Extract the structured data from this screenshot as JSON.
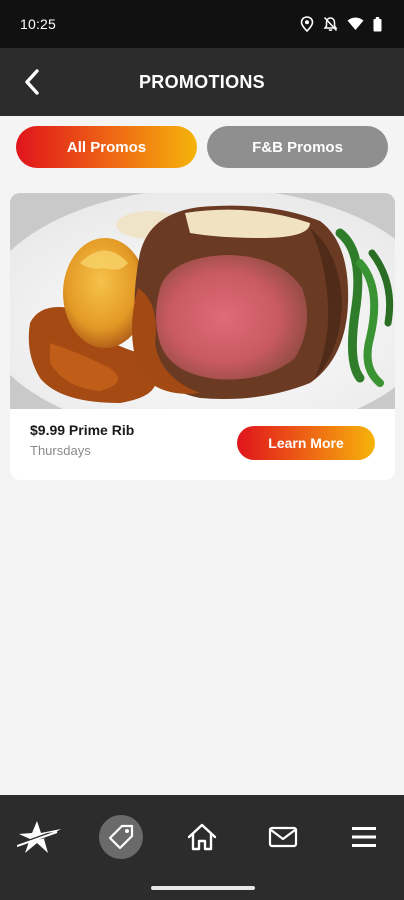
{
  "status_bar": {
    "time": "10:25"
  },
  "header": {
    "title": "PROMOTIONS"
  },
  "filters": {
    "all_label": "All Promos",
    "fnb_label": "F&B Promos"
  },
  "promo": {
    "title": "$9.99 Prime Rib",
    "subtitle": "Thursdays",
    "button_label": "Learn More"
  },
  "bottom_nav": {
    "items": [
      "star-logo-icon",
      "tag-icon",
      "home-icon",
      "mail-icon",
      "menu-icon"
    ],
    "active": "tag-icon"
  },
  "colors": {
    "accent_start": "#e0141c",
    "accent_end": "#f5b40a",
    "header_bg": "#2c2c2c",
    "inactive_tab": "#8f8f8f"
  }
}
